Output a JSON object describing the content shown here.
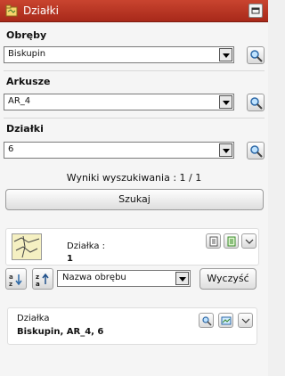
{
  "window": {
    "title": "Działki",
    "app_icon": "map-folder-icon",
    "accent": "#b5321f"
  },
  "filters": {
    "obreby": {
      "label": "Obręby",
      "value": "Biskupin"
    },
    "arkusze": {
      "label": "Arkusze",
      "value": "AR_4"
    },
    "dzialki": {
      "label": "Działki",
      "value": "6"
    }
  },
  "results": {
    "text": "Wyniki wyszukiwania : 1 / 1"
  },
  "search_button": {
    "label": "Szukaj"
  },
  "parcel_card": {
    "label": "Działka :",
    "number": "1"
  },
  "sorting": {
    "select_value": "Nazwa obrębu"
  },
  "clear_button": {
    "label": "Wyczyść"
  },
  "result_item": {
    "label": "Działka",
    "value": "Biskupin, AR_4, 6"
  }
}
